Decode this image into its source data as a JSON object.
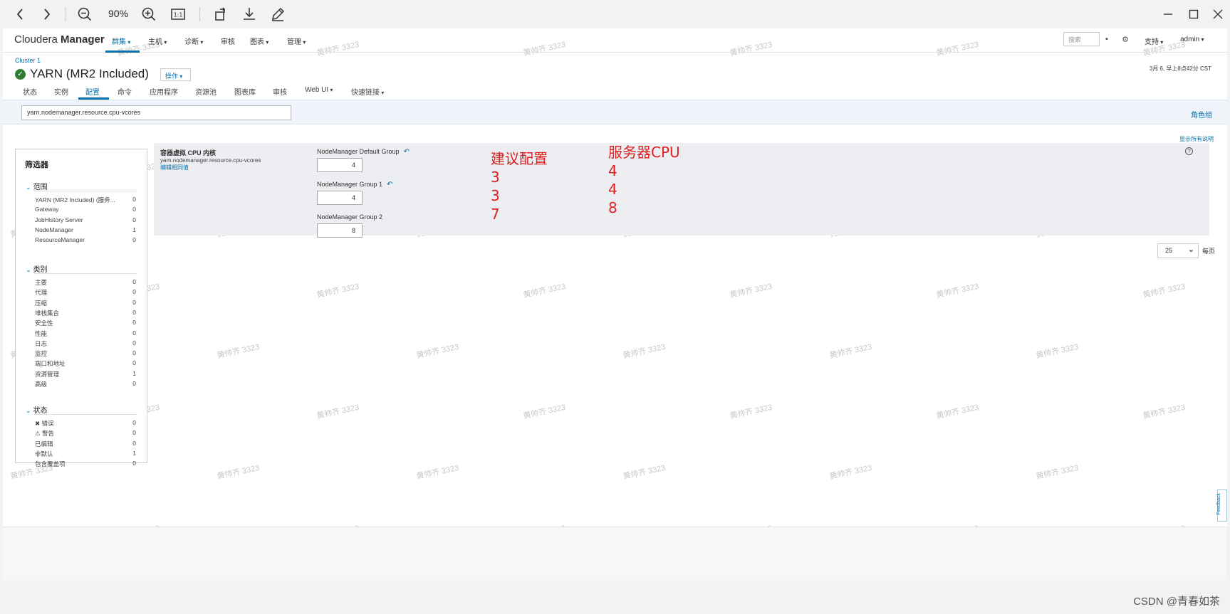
{
  "viewer": {
    "zoom": "90%",
    "buttons": [
      "back-arrow-icon",
      "forward-arrow-icon",
      "zoom-out-icon",
      "zoom-in-icon",
      "actual-size-icon",
      "rotate-icon",
      "download-icon",
      "edit-pen-icon"
    ],
    "window_controls": [
      "minimize-icon",
      "maximize-icon",
      "close-icon"
    ]
  },
  "header": {
    "brand_light": "Cloudera",
    "brand_bold": "Manager",
    "nav": [
      "群集",
      "主机",
      "诊断",
      "审核",
      "图表",
      "管理"
    ],
    "active_nav": "群集",
    "search_placeholder": "搜索",
    "support": "支持",
    "user": "admin"
  },
  "service": {
    "cluster": "Cluster 1",
    "title": "YARN (MR2 Included)",
    "status": "good",
    "actions": "操作",
    "timestamp": "3月 6, 早上8点42分 CST"
  },
  "tabs": {
    "items": [
      "状态",
      "实例",
      "配置",
      "命令",
      "应用程序",
      "资源池",
      "图表库",
      "审核",
      "Web UI",
      "快速链接"
    ],
    "active": "配置"
  },
  "search": {
    "value": "yarn.nodemanager.resource.cpu-vcores",
    "role_groups": "角色组"
  },
  "filters": {
    "title": "筛选器",
    "scope": {
      "title": "范围",
      "items": [
        {
          "label": "YARN (MR2 Included) (服务...",
          "count": "0"
        },
        {
          "label": "Gateway",
          "count": "0"
        },
        {
          "label": "JobHistory Server",
          "count": "0"
        },
        {
          "label": "NodeManager",
          "count": "1"
        },
        {
          "label": "ResourceManager",
          "count": "0"
        }
      ]
    },
    "category": {
      "title": "类别",
      "items": [
        {
          "label": "主要",
          "count": "0"
        },
        {
          "label": "代理",
          "count": "0"
        },
        {
          "label": "压缩",
          "count": "0"
        },
        {
          "label": "堆栈集合",
          "count": "0"
        },
        {
          "label": "安全性",
          "count": "0"
        },
        {
          "label": "性能",
          "count": "0"
        },
        {
          "label": "日志",
          "count": "0"
        },
        {
          "label": "监控",
          "count": "0"
        },
        {
          "label": "端口和地址",
          "count": "0"
        },
        {
          "label": "资源管理",
          "count": "1"
        },
        {
          "label": "高级",
          "count": "0"
        }
      ]
    },
    "status": {
      "title": "状态",
      "items": [
        {
          "label": "错误",
          "count": "0"
        },
        {
          "label": "警告",
          "count": "0"
        },
        {
          "label": "已编辑",
          "count": "0"
        },
        {
          "label": "非默认",
          "count": "1"
        },
        {
          "label": "包含覆盖项",
          "count": "0"
        }
      ]
    }
  },
  "config": {
    "show_all_desc": "显示所有说明",
    "name": "容器虚拟 CPU 内核",
    "key": "yarn.nodemanager.resource.cpu-vcores",
    "edit_link": "编辑相同值",
    "groups": [
      {
        "label": "NodeManager Default Group",
        "value": "4"
      },
      {
        "label": "NodeManager Group 1",
        "value": "4"
      },
      {
        "label": "NodeManager Group 2",
        "value": "8"
      }
    ]
  },
  "annotation": {
    "col1_title": "建议配置",
    "col1_values": [
      "3",
      "3",
      "7"
    ],
    "col2_title": "服务器CPU",
    "col2_values": [
      "4",
      "4",
      "8"
    ],
    "color": "#dd1f1f"
  },
  "pager": {
    "per_page": "25",
    "label": "每页"
  },
  "feedback": "Feedback",
  "watermark_text": "黄帅齐 3323",
  "credit": "CSDN @青春如茶",
  "colors": {
    "accent": "#0a6fa8",
    "ok": "#2e7d32"
  }
}
